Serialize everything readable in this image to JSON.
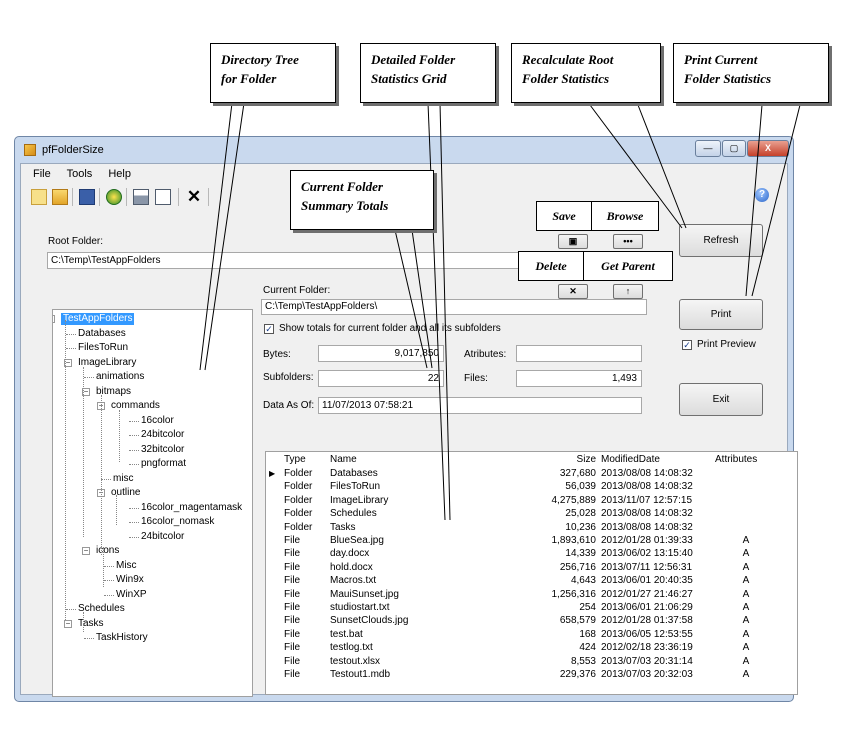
{
  "window": {
    "title": "pfFolderSize",
    "min_label": "—",
    "max_label": "▢",
    "close_label": "X"
  },
  "menu": [
    "File",
    "Tools",
    "Help"
  ],
  "toolbar": {
    "icons": [
      "new-icon",
      "open-icon",
      "save-icon",
      "refresh-icon",
      "print-icon",
      "print-preview-icon",
      "delete-icon"
    ],
    "help_glyph": "?"
  },
  "root_folder": {
    "label": "Root Folder:",
    "value": "C:\\Temp\\TestAppFolders"
  },
  "small_buttons": {
    "save_glyph": "▣",
    "browse_glyph": "•••",
    "delete_glyph": "✕",
    "parent_glyph": "↑"
  },
  "buttons": {
    "refresh": "Refresh",
    "print": "Print",
    "exit": "Exit"
  },
  "print_preview": {
    "label": "Print Preview",
    "checked": true
  },
  "current_folder": {
    "label": "Current Folder:",
    "value": "C:\\Temp\\TestAppFolders\\",
    "show_totals_label": "Show totals for current folder and all its subfolders",
    "show_totals_checked": true
  },
  "stats": {
    "bytes_label": "Bytes:",
    "bytes_value": "9,017,850",
    "attributes_label": "Atributes:",
    "attributes_value": "",
    "subfolders_label": "Subfolders:",
    "subfolders_value": "22",
    "files_label": "Files:",
    "files_value": "1,493",
    "data_as_of_label": "Data As Of:",
    "data_as_of_value": "11/07/2013 07:58:21"
  },
  "tree": {
    "nodes": [
      {
        "label": "TestAppFolders",
        "selected": true
      },
      {
        "label": "Databases"
      },
      {
        "label": "FilesToRun"
      },
      {
        "label": "ImageLibrary"
      },
      {
        "label": "animations"
      },
      {
        "label": "bitmaps"
      },
      {
        "label": "commands"
      },
      {
        "label": "16color"
      },
      {
        "label": "24bitcolor"
      },
      {
        "label": "32bitcolor"
      },
      {
        "label": "pngformat"
      },
      {
        "label": "misc"
      },
      {
        "label": "outline"
      },
      {
        "label": "16color_magentamask"
      },
      {
        "label": "16color_nomask"
      },
      {
        "label": "24bitcolor"
      },
      {
        "label": "icons"
      },
      {
        "label": "Misc"
      },
      {
        "label": "Win9x"
      },
      {
        "label": "WinXP"
      },
      {
        "label": "Schedules"
      },
      {
        "label": "Tasks"
      },
      {
        "label": "TaskHistory"
      }
    ]
  },
  "grid": {
    "columns": [
      "Type",
      "Name",
      "Size",
      "ModifiedDate",
      "Attributes"
    ],
    "rows": [
      [
        "Folder",
        "Databases",
        "327,680",
        "2013/08/08 14:08:32",
        ""
      ],
      [
        "Folder",
        "FilesToRun",
        "56,039",
        "2013/08/08 14:08:32",
        ""
      ],
      [
        "Folder",
        "ImageLibrary",
        "4,275,889",
        "2013/11/07 12:57:15",
        ""
      ],
      [
        "Folder",
        "Schedules",
        "25,028",
        "2013/08/08 14:08:32",
        ""
      ],
      [
        "Folder",
        "Tasks",
        "10,236",
        "2013/08/08 14:08:32",
        ""
      ],
      [
        "File",
        "BlueSea.jpg",
        "1,893,610",
        "2012/01/28 01:39:33",
        "A"
      ],
      [
        "File",
        "day.docx",
        "14,339",
        "2013/06/02 13:15:40",
        "A"
      ],
      [
        "File",
        "hold.docx",
        "256,716",
        "2013/07/11 12:56:31",
        "A"
      ],
      [
        "File",
        "Macros.txt",
        "4,643",
        "2013/06/01 20:40:35",
        "A"
      ],
      [
        "File",
        "MauiSunset.jpg",
        "1,256,316",
        "2012/01/27 21:46:27",
        "A"
      ],
      [
        "File",
        "studiostart.txt",
        "254",
        "2013/06/01 21:06:29",
        "A"
      ],
      [
        "File",
        "SunsetClouds.jpg",
        "658,579",
        "2012/01/28 01:37:58",
        "A"
      ],
      [
        "File",
        "test.bat",
        "168",
        "2013/06/05 12:53:55",
        "A"
      ],
      [
        "File",
        "testlog.txt",
        "424",
        "2012/02/18 23:36:19",
        "A"
      ],
      [
        "File",
        "testout.xlsx",
        "8,553",
        "2013/07/03 20:31:14",
        "A"
      ],
      [
        "File",
        "Testout1.mdb",
        "229,376",
        "2013/07/03 20:32:03",
        "A"
      ]
    ],
    "row_indicator": "▶"
  },
  "callouts": {
    "directory_tree": [
      "Directory Tree",
      "for Folder"
    ],
    "stats_grid": [
      "Detailed Folder",
      "Statistics Grid"
    ],
    "recalculate": [
      "Recalculate Root",
      "Folder Statistics"
    ],
    "print_current": [
      "Print Current",
      "Folder Statistics"
    ],
    "summary_totals": [
      "Current Folder",
      "Summary Totals"
    ],
    "save": "Save",
    "browse": "Browse",
    "delete": "Delete",
    "get_parent": "Get Parent"
  }
}
